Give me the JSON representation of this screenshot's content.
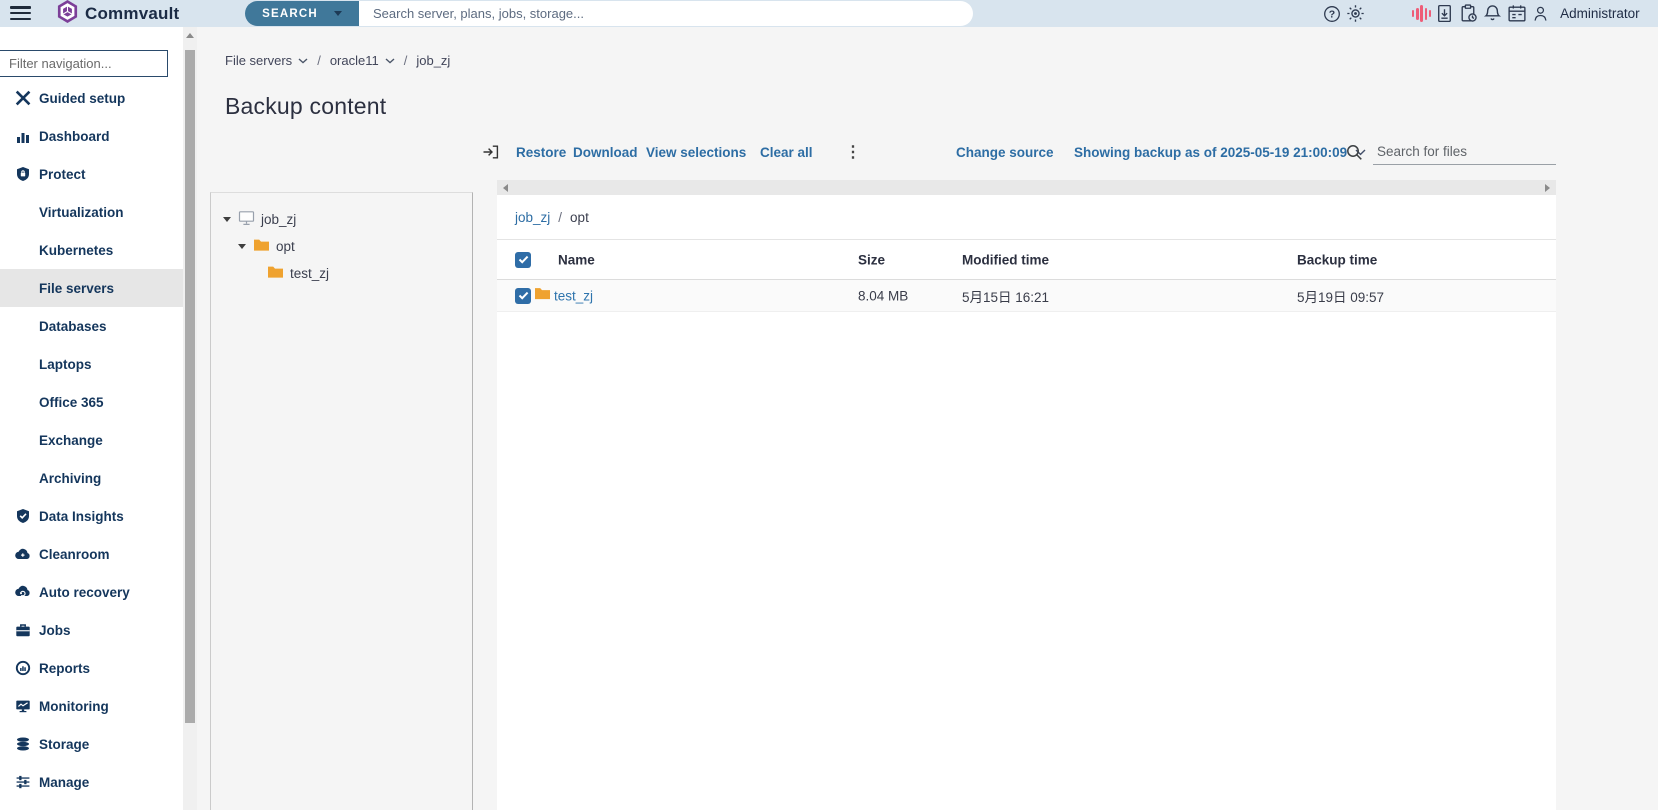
{
  "topbar": {
    "brand": "Commvault",
    "search_button_label": "SEARCH",
    "search_placeholder": "Search server, plans, jobs, storage...",
    "username": "Administrator",
    "icons": [
      "menu",
      "help",
      "theme-brightness",
      "ai-waveform",
      "download-center",
      "audit-clipboard",
      "alerts-bell",
      "events-calendar",
      "user"
    ]
  },
  "sidebar": {
    "filter_placeholder": "Filter navigation...",
    "items": [
      {
        "label": "Guided setup",
        "icon": "tools"
      },
      {
        "label": "Dashboard",
        "icon": "bar-chart"
      },
      {
        "label": "Protect",
        "icon": "shield-lock"
      },
      {
        "label": "Virtualization",
        "indent": true
      },
      {
        "label": "Kubernetes",
        "indent": true
      },
      {
        "label": "File servers",
        "indent": true,
        "selected": true
      },
      {
        "label": "Databases",
        "indent": true
      },
      {
        "label": "Laptops",
        "indent": true
      },
      {
        "label": "Office 365",
        "indent": true
      },
      {
        "label": "Exchange",
        "indent": true
      },
      {
        "label": "Archiving",
        "indent": true
      },
      {
        "label": "Data Insights",
        "icon": "shield-check"
      },
      {
        "label": "Cleanroom",
        "icon": "cloud"
      },
      {
        "label": "Auto recovery",
        "icon": "cloud-recovery"
      },
      {
        "label": "Jobs",
        "icon": "briefcase"
      },
      {
        "label": "Reports",
        "icon": "donut-chart"
      },
      {
        "label": "Monitoring",
        "icon": "monitor"
      },
      {
        "label": "Storage",
        "icon": "database"
      },
      {
        "label": "Manage",
        "icon": "sliders"
      }
    ]
  },
  "page": {
    "breadcrumb": {
      "level1": "File servers",
      "level2": "oracle11",
      "level3": "job_zj"
    },
    "title": "Backup content"
  },
  "toolbar": {
    "restore": "Restore",
    "download": "Download",
    "view_selections": "View selections",
    "clear_all": "Clear all",
    "change_source": "Change source",
    "showing_backup": "Showing backup as of 2025-05-19 21:00:09",
    "file_search_placeholder": "Search for files"
  },
  "tree": {
    "items": [
      {
        "label": "job_zj",
        "type": "computer",
        "expanded": true
      },
      {
        "label": "opt",
        "type": "folder",
        "expanded": true
      },
      {
        "label": "test_zj",
        "type": "folder"
      }
    ]
  },
  "content_table": {
    "breadcrumb": {
      "parent": "job_zj",
      "current": "opt"
    },
    "columns": {
      "name": "Name",
      "size": "Size",
      "modified": "Modified time",
      "backup": "Backup time"
    },
    "rows": [
      {
        "name": "test_zj",
        "size": "8.04 MB",
        "modified": "5月15日 16:21",
        "backup": "5月19日 09:57",
        "selected": true
      }
    ]
  },
  "colors": {
    "topbar_bg": "#d8e4ee",
    "accent_blue": "#2d6da4",
    "button_blue": "#40789a",
    "navy": "#14365c",
    "selected_bg": "#e6e6e6",
    "folder_yellow": "#efa22f",
    "ai_pink": "#ee5d78",
    "page_bg": "#f5f5f5"
  }
}
